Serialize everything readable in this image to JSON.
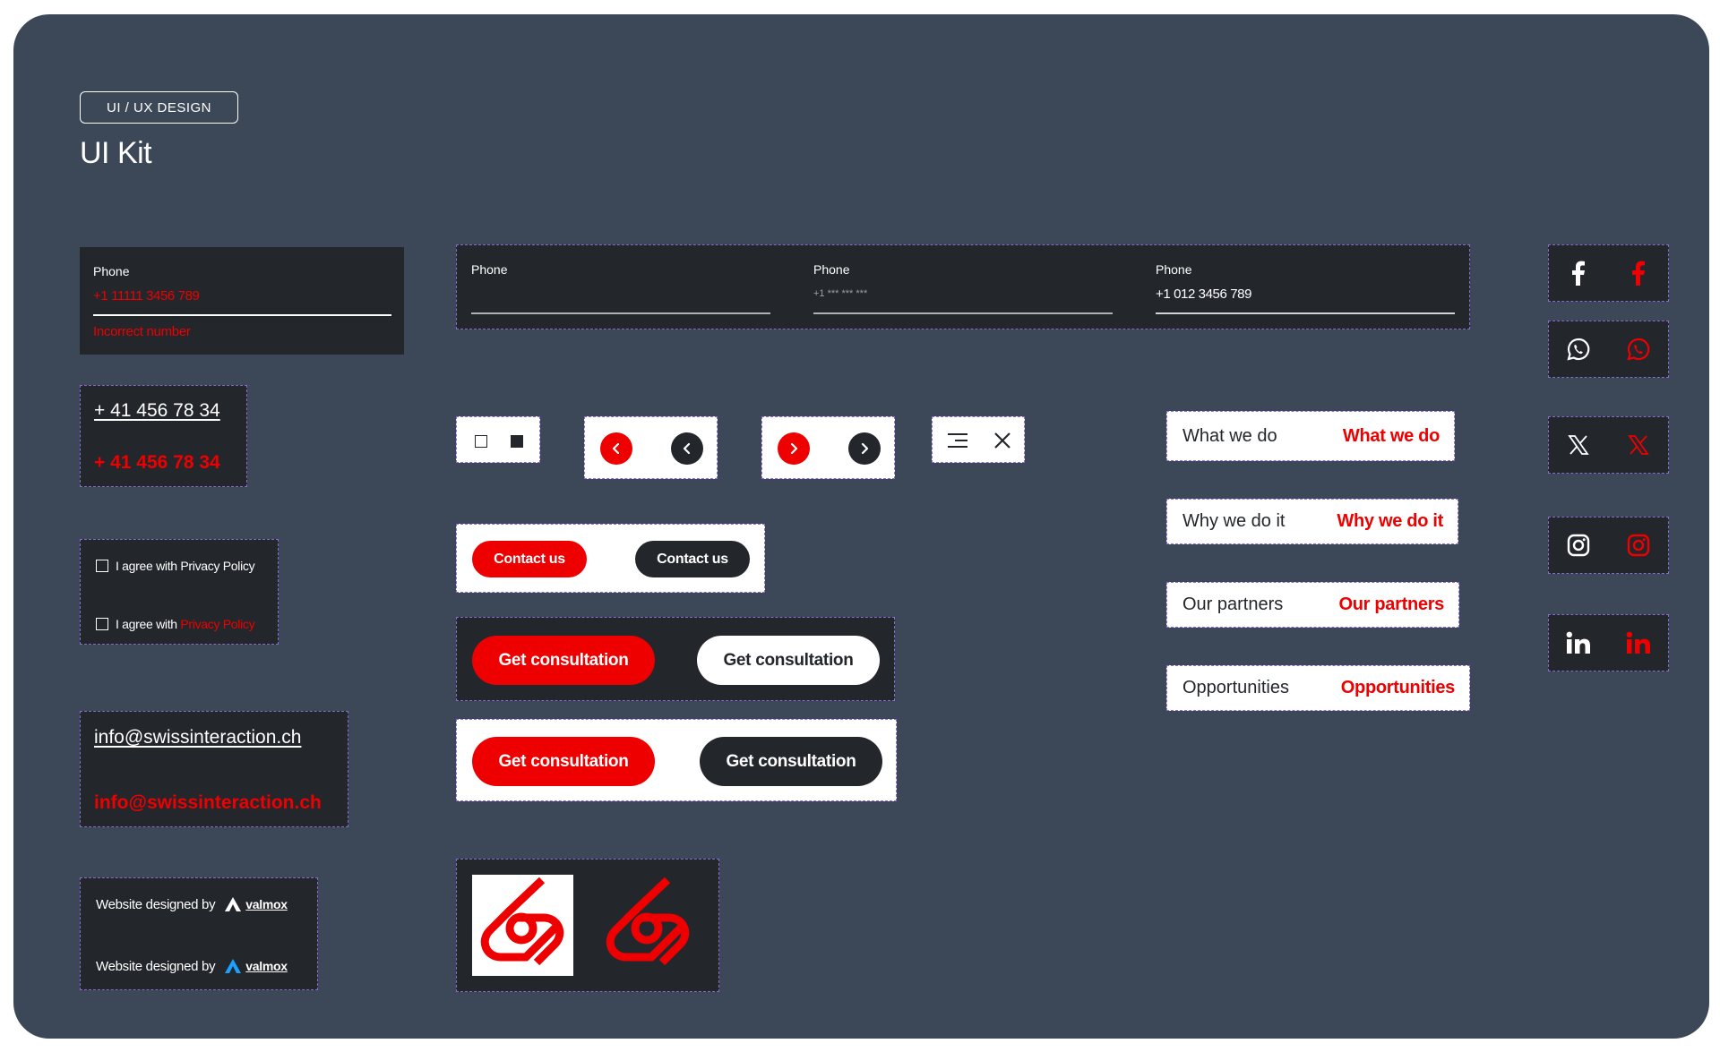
{
  "header": {
    "tag": "UI / UX DESIGN",
    "title": "UI Kit"
  },
  "phone_error": {
    "label": "Phone",
    "value": "+1 11111 3456 789",
    "error": "Incorrect number"
  },
  "phone_states": [
    {
      "label": "Phone",
      "value": ""
    },
    {
      "label": "Phone",
      "value": "+1 *** *** ***"
    },
    {
      "label": "Phone",
      "value": "+1 012 3456 789"
    }
  ],
  "phone_links": {
    "normal": "+ 41 456 78 34",
    "hover": "+ 41 456 78 34"
  },
  "consent": {
    "prefix": "I agree with",
    "link": "Privacy Policy"
  },
  "email": {
    "normal": "info@swissinteraction.ch",
    "hover": "info@swissinteraction.ch"
  },
  "credit": {
    "text": "Website designed by",
    "brand": "valmox"
  },
  "buttons": {
    "contact": "Contact us",
    "consultation": "Get consultation"
  },
  "nav": {
    "items": [
      "What we do",
      "Why we do it",
      "Our partners",
      "Opportunities"
    ]
  },
  "social": [
    "facebook",
    "whatsapp",
    "x",
    "instagram",
    "linkedin"
  ],
  "colors": {
    "canvas": "#3c4858",
    "dark": "#23262b",
    "accent": "#ee0000",
    "dash": "#8a6bd0"
  }
}
